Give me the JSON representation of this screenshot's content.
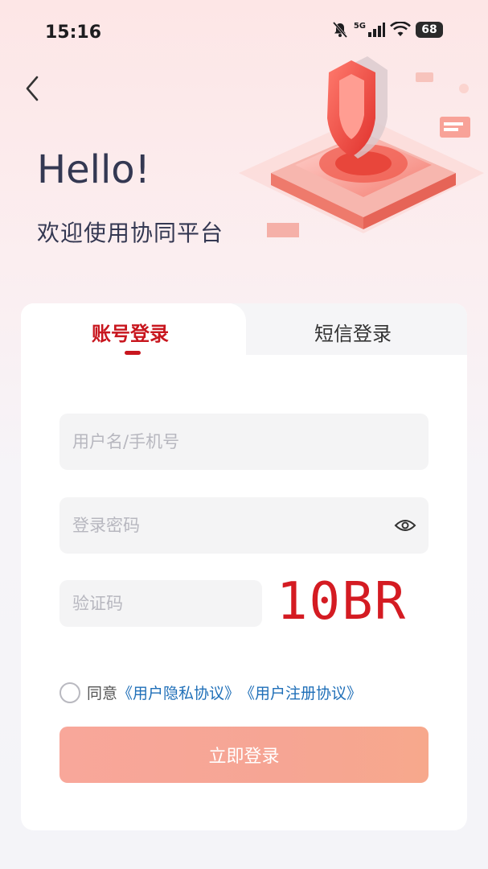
{
  "status_bar": {
    "time": "15:16",
    "network": "5G",
    "battery": "68"
  },
  "header": {
    "greeting": "Hello!",
    "welcome": "欢迎使用协同平台"
  },
  "tabs": [
    {
      "label": "账号登录",
      "active": true
    },
    {
      "label": "短信登录",
      "active": false
    }
  ],
  "form": {
    "username_placeholder": "用户名/手机号",
    "password_placeholder": "登录密码",
    "captcha_placeholder": "验证码",
    "captcha_image_text": "10BR"
  },
  "agreement": {
    "prefix": "同意",
    "privacy_link": "《用户隐私协议》",
    "register_link": "《用户注册协议》"
  },
  "submit_label": "立即登录",
  "colors": {
    "accent": "#c8161e",
    "button": "#f8a79a",
    "link": "#1f6fb8"
  }
}
